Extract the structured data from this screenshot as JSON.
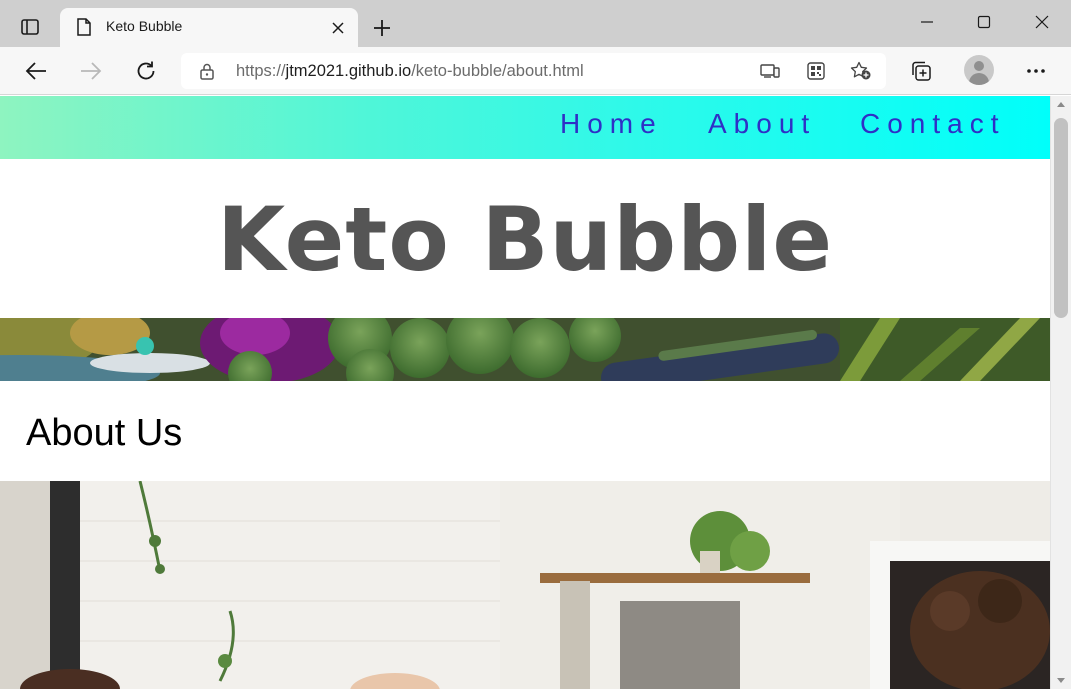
{
  "browser": {
    "tab": {
      "title": "Keto Bubble",
      "icon": "page-icon",
      "close_icon": "close-icon"
    },
    "new_tab_icon": "plus-icon",
    "window_controls": [
      "minimize-icon",
      "maximize-icon",
      "close-icon"
    ],
    "toolbar": {
      "back_icon": "back-arrow-icon",
      "forward_icon": "forward-arrow-icon",
      "reload_icon": "reload-icon",
      "address": {
        "url_prefix": "https://",
        "url_host": "jtm2021.github.io",
        "url_path": "/keto-bubble/about.html",
        "lock_icon": "lock-icon"
      },
      "address_icons": [
        "open-in-app-icon",
        "qr-code-icon",
        "add-favorite-icon"
      ],
      "right_icons": [
        "collections-icon",
        "profile-avatar",
        "more-menu-icon"
      ]
    }
  },
  "site": {
    "nav": {
      "items": [
        {
          "label": "Home"
        },
        {
          "label": "About"
        },
        {
          "label": "Contact"
        }
      ],
      "gradient_start": "#8ef4c0",
      "gradient_end": "#00fffa",
      "link_color": "#2f2fc6"
    },
    "brand_title": "Keto Bubble",
    "brand_color": "#555555",
    "banner_image": "vegetables-banner",
    "section_heading": "About Us",
    "team_image": "team-kitchen-photo"
  }
}
